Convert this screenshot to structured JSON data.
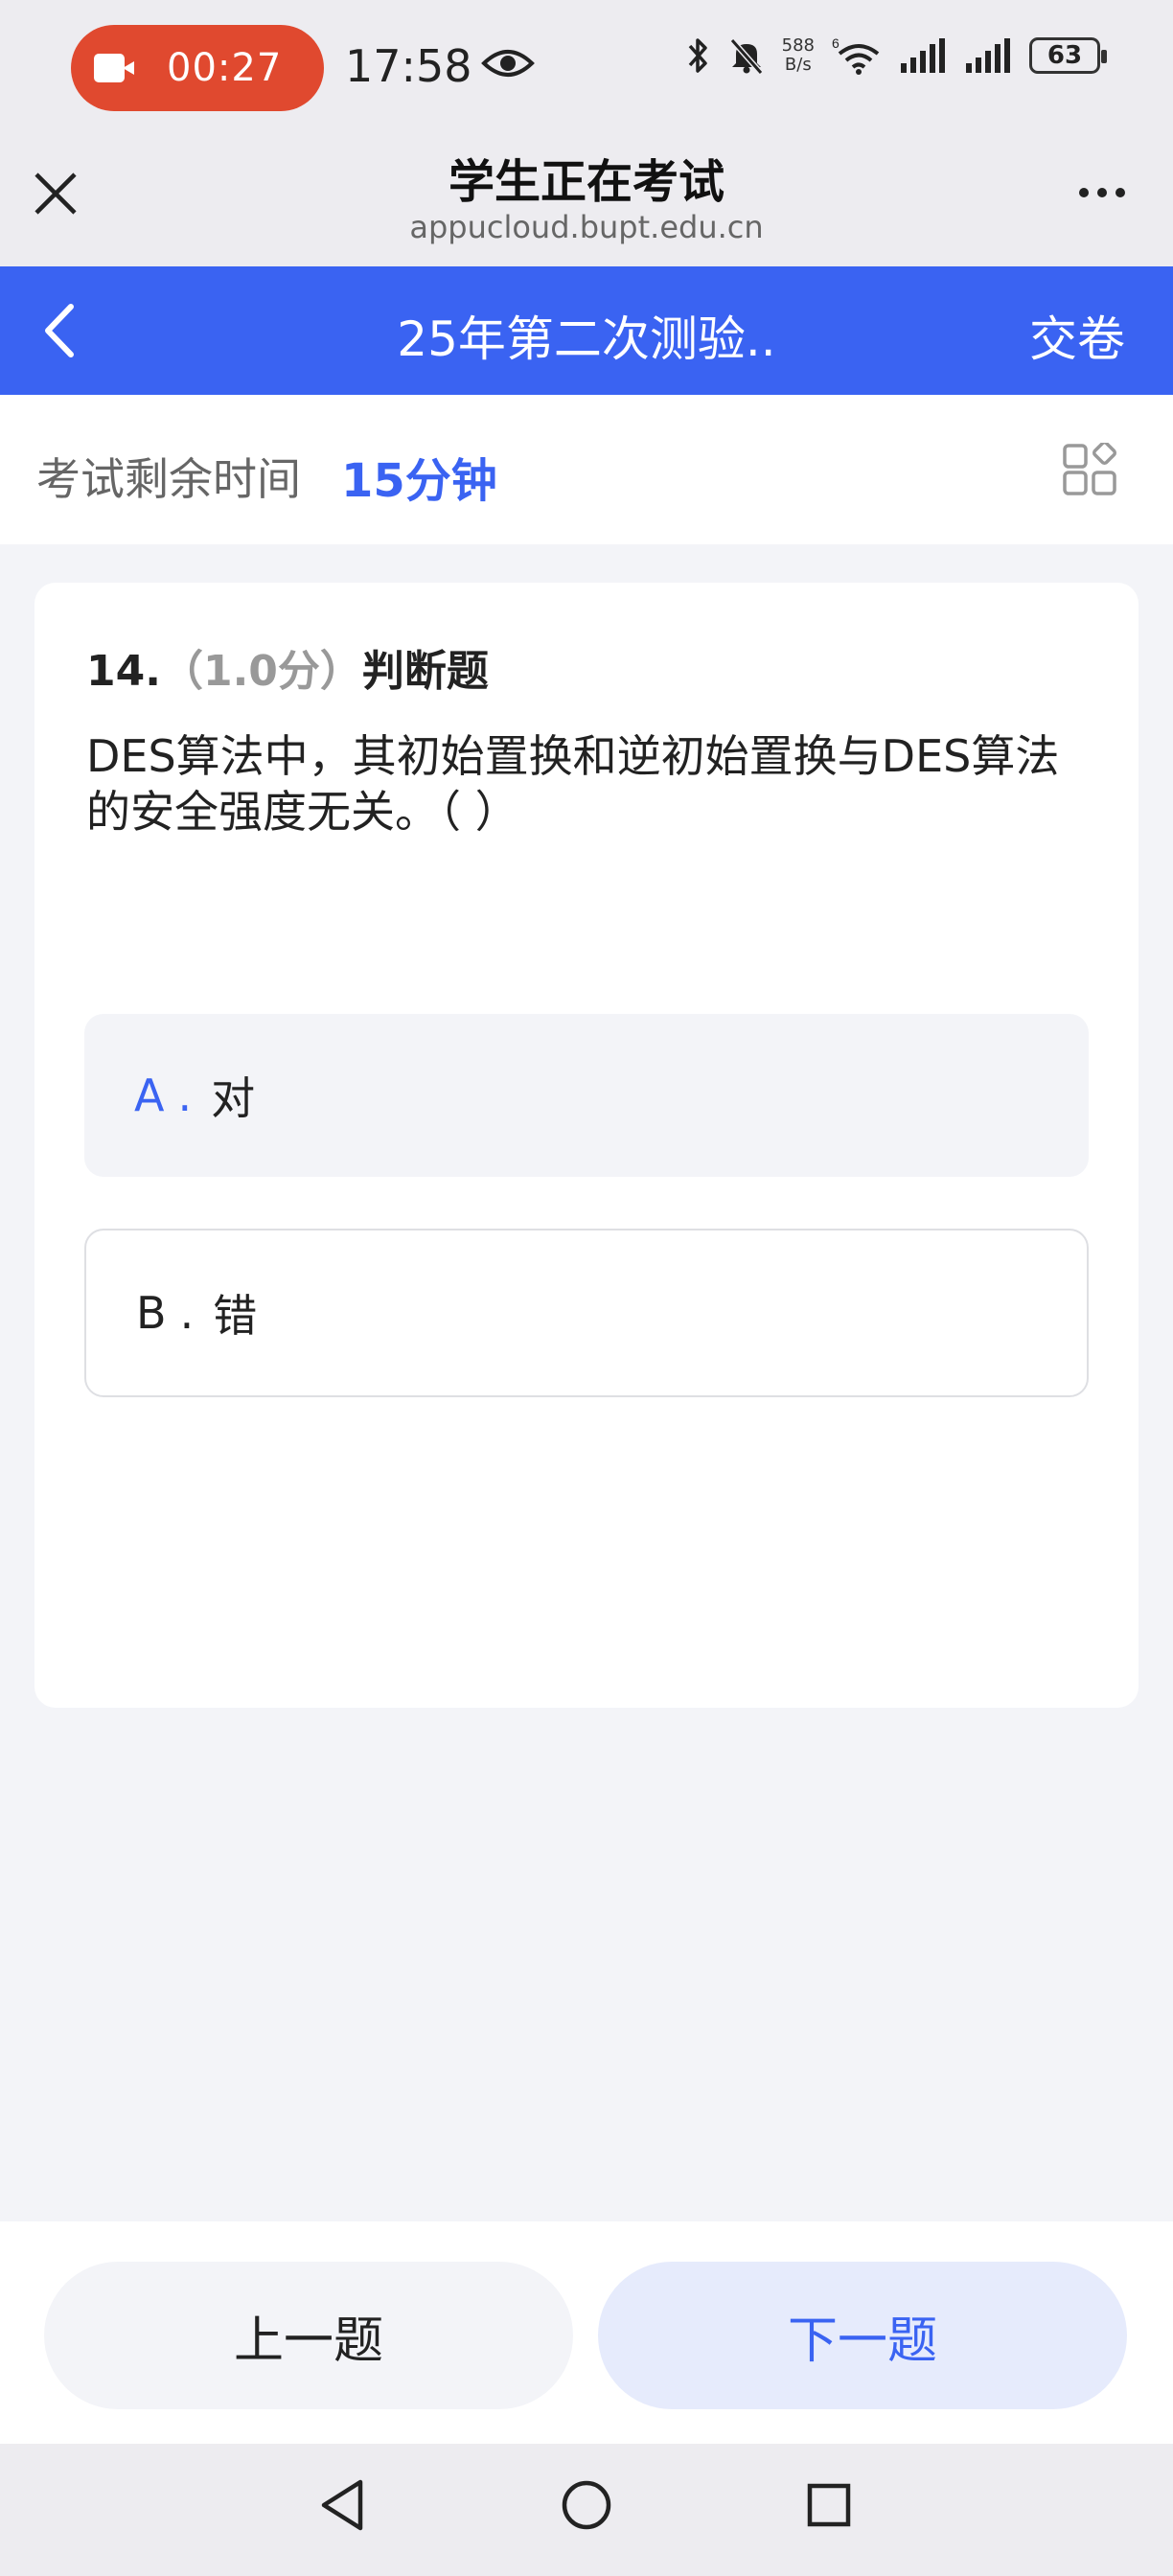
{
  "status_bar": {
    "recording_time": "00:27",
    "clock": "17:58",
    "net_speed_value": "588",
    "net_speed_unit": "B/s",
    "battery": "63",
    "icons": [
      "video-camera-icon",
      "eye-icon",
      "bluetooth-icon",
      "mute-icon",
      "wifi-icon",
      "signal-icon",
      "signal-icon",
      "battery-icon"
    ]
  },
  "browser": {
    "title": "学生正在考试",
    "url": "appucloud.bupt.edu.cn"
  },
  "nav": {
    "title": "25年第二次测验..",
    "submit_label": "交卷",
    "accent_color": "#3a63f2"
  },
  "timer": {
    "label": "考试剩余时间",
    "value": "15分钟"
  },
  "question": {
    "number": "14.",
    "score": "（1.0分）",
    "type": "判断题",
    "text": "DES算法中，其初始置换和逆初始置换与DES算法的安全强度无关。（ ）",
    "options": [
      {
        "letter": "A",
        "dot": ".",
        "text": "对",
        "selected": true
      },
      {
        "letter": "B",
        "dot": ".",
        "text": "错",
        "selected": false
      }
    ]
  },
  "footer": {
    "prev_label": "上一题",
    "next_label": "下一题"
  }
}
